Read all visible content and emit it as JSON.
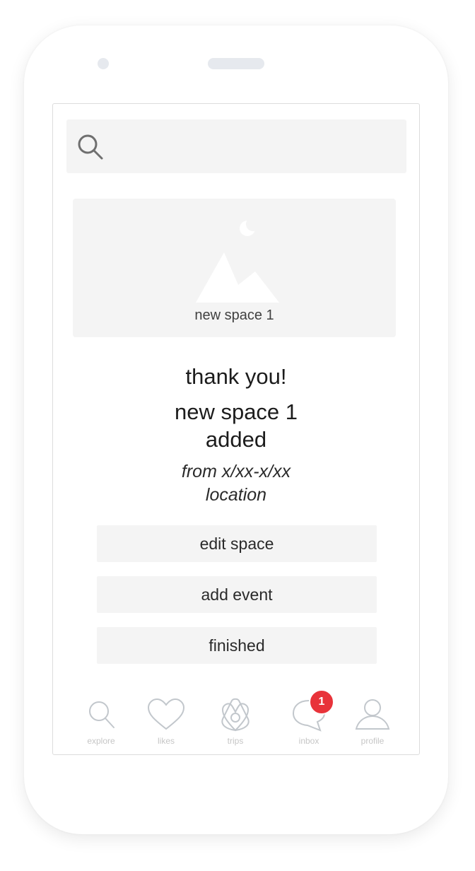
{
  "search": {
    "icon": "search-icon"
  },
  "card": {
    "image_icon": "mountain-moon-icon",
    "label": "new space 1"
  },
  "message": {
    "thanks": "thank you!",
    "space_name": "new space 1",
    "added": "added",
    "dates": "from x/xx-x/xx",
    "location": "location"
  },
  "actions": {
    "edit_label": "edit space",
    "add_event_label": "add event",
    "finished_label": "finished"
  },
  "tabbar": {
    "tabs": [
      {
        "label": "explore",
        "icon": "search-icon"
      },
      {
        "label": "likes",
        "icon": "heart-icon"
      },
      {
        "label": "trips",
        "icon": "airbnb-logo-icon"
      },
      {
        "label": "inbox",
        "icon": "chat-bubble-icon",
        "badge": "1"
      },
      {
        "label": "profile",
        "icon": "user-icon"
      }
    ]
  },
  "colors": {
    "badge": "#e8333a",
    "panel": "#f4f4f4"
  }
}
